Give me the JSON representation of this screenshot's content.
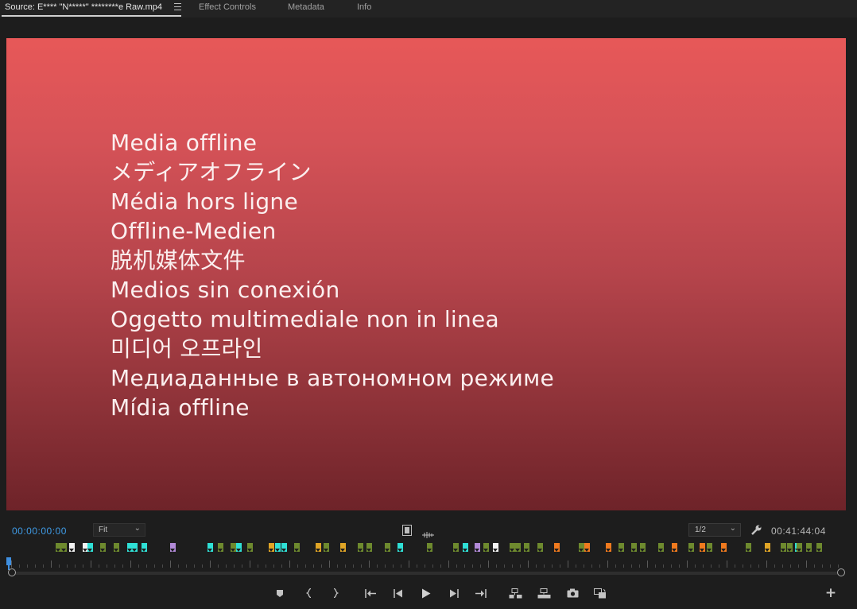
{
  "tabs": [
    {
      "label": "Source: E**** \"N*****\" ********e Raw.mp4",
      "active": true
    },
    {
      "label": "Effect Controls",
      "active": false
    },
    {
      "label": "Metadata",
      "active": false
    },
    {
      "label": "Info",
      "active": false
    }
  ],
  "monitor": {
    "offline_lines": [
      "Media offline",
      "メディアオフライン",
      "Média hors ligne",
      "Offline-Medien",
      "脱机媒体文件",
      "Medios sin conexión",
      "Oggetto multimediale non in linea",
      "미디어 오프라인",
      "Медиаданные в автономном режиме",
      "Mídia offline"
    ],
    "gradient_top": "#e75858",
    "gradient_bottom": "#6e2329"
  },
  "controls": {
    "timecode_in": "00:00:00:00",
    "zoom_select": "Fit",
    "resolution_select": "1/2",
    "duration": "00:41:44:04"
  },
  "markers": {
    "colors": {
      "green": "#6e8a2e",
      "white": "#f2f2f2",
      "cyan": "#2fe0d6",
      "purple": "#b28ad8",
      "orange": "#f07a1e",
      "yellow": "#e0a526"
    },
    "sequence": [
      "green",
      "green",
      "white",
      "white",
      "cyan",
      "green",
      "green",
      "cyan",
      "cyan",
      "cyan",
      "purple",
      "cyan",
      "green",
      "green",
      "cyan",
      "green",
      "yellow",
      "cyan",
      "cyan",
      "green",
      "yellow",
      "green",
      "yellow",
      "green",
      "green",
      "green",
      "cyan",
      "green",
      "green",
      "cyan",
      "purple",
      "green",
      "white",
      "green",
      "green",
      "green",
      "green",
      "orange",
      "green",
      "orange",
      "orange",
      "green",
      "green",
      "green",
      "green",
      "orange",
      "green",
      "orange",
      "green",
      "orange",
      "green",
      "yellow",
      "green",
      "green",
      "cyan",
      "green",
      "green",
      "green"
    ]
  },
  "transport": {
    "buttons": [
      "add-marker-icon",
      "mark-in-icon",
      "mark-out-icon",
      "go-to-in-icon",
      "step-back-icon",
      "play-icon",
      "step-forward-icon",
      "go-to-out-icon",
      "insert-icon",
      "overwrite-icon",
      "export-frame-icon",
      "button-editor-icon"
    ],
    "add_button": "+"
  }
}
